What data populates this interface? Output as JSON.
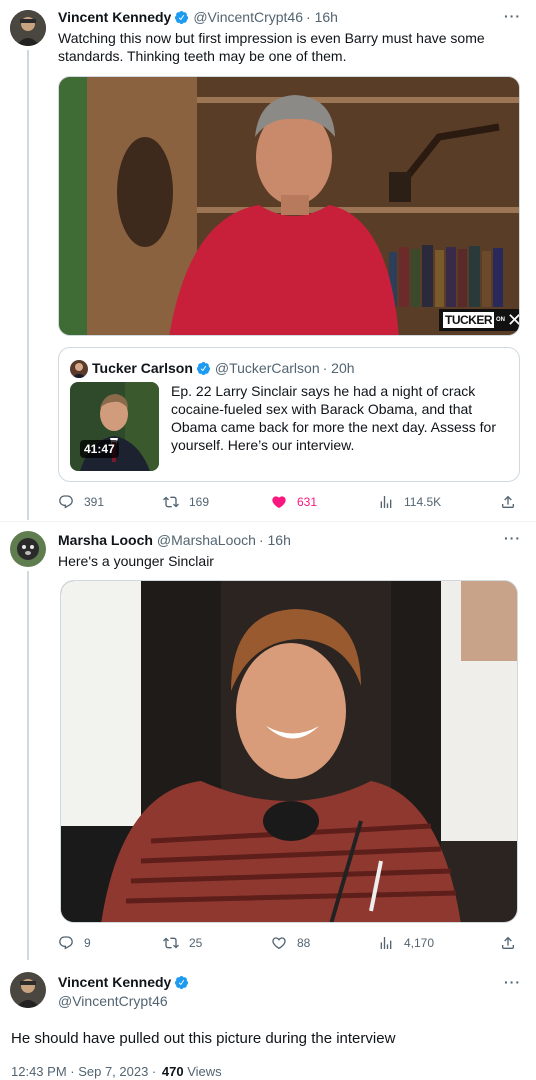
{
  "tweet1": {
    "name": "Vincent Kennedy",
    "handle": "@VincentCrypt46",
    "time": "· 16h",
    "text": "Watching this now but first impression is even Barry must have some standards. Thinking teeth may be one of them.",
    "video_brand": "TUCKER",
    "video_brand_suffix": "ON",
    "quote": {
      "name": "Tucker Carlson",
      "handle": "@TuckerCarlson",
      "time": "· 20h",
      "text": "Ep. 22  Larry Sinclair says he had a night of crack cocaine-fueled sex with Barack Obama, and that Obama came back for more the next day. Assess for yourself. Here’s our interview.",
      "duration": "41:47"
    },
    "stats": {
      "replies": "391",
      "retweets": "169",
      "likes": "631",
      "views": "114.5K"
    }
  },
  "tweet2": {
    "name": "Marsha Looch",
    "handle": "@MarshaLooch",
    "time": "· 16h",
    "text": "Here's a younger Sinclair",
    "stats": {
      "replies": "9",
      "retweets": "25",
      "likes": "88",
      "views": "4,170"
    }
  },
  "tweet3": {
    "name": "Vincent Kennedy",
    "handle": "@VincentCrypt46",
    "text": "He should have pulled out this picture during the interview",
    "time": "12:43 PM · Sep 7, 2023 ·",
    "views_count": "470",
    "views_label": "Views"
  },
  "colors": {
    "verified": "#1d9bf0",
    "like": "#f91880",
    "muted": "#536471"
  }
}
